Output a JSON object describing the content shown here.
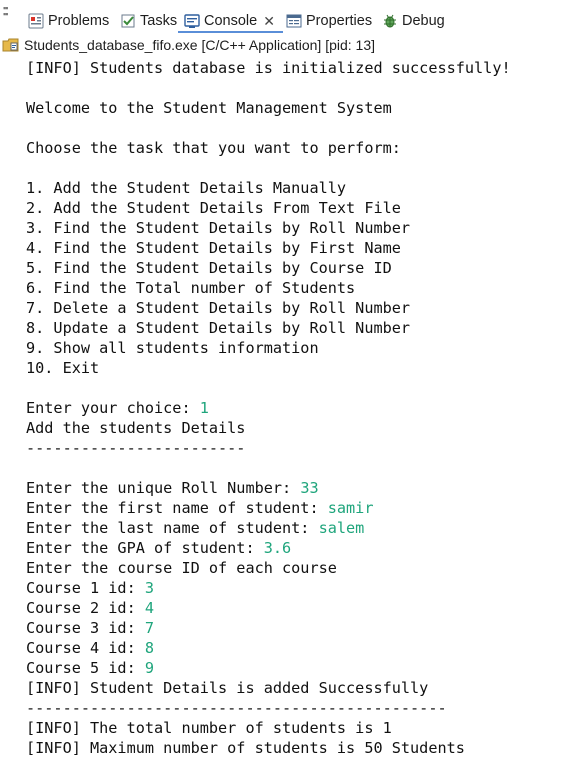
{
  "tabs": [
    {
      "label": "Problems",
      "icon": "problems-icon"
    },
    {
      "label": "Tasks",
      "icon": "tasks-icon"
    },
    {
      "label": "Console",
      "icon": "console-icon",
      "active": true
    },
    {
      "label": "Properties",
      "icon": "properties-icon"
    },
    {
      "label": "Debug",
      "icon": "debug-icon"
    }
  ],
  "process_label": "Students_database_fifo.exe [C/C++ Application]  [pid: 13]",
  "console_lines": [
    {
      "text": "[INFO] Students database is initialized successfully!",
      "input": ""
    },
    {
      "text": "",
      "input": ""
    },
    {
      "text": "Welcome to the Student Management System",
      "input": ""
    },
    {
      "text": "",
      "input": ""
    },
    {
      "text": "Choose the task that you want to perform:",
      "input": ""
    },
    {
      "text": "",
      "input": ""
    },
    {
      "text": "1. Add the Student Details Manually",
      "input": ""
    },
    {
      "text": "2. Add the Student Details From Text File",
      "input": ""
    },
    {
      "text": "3. Find the Student Details by Roll Number",
      "input": ""
    },
    {
      "text": "4. Find the Student Details by First Name",
      "input": ""
    },
    {
      "text": "5. Find the Student Details by Course ID",
      "input": ""
    },
    {
      "text": "6. Find the Total number of Students",
      "input": ""
    },
    {
      "text": "7. Delete a Student Details by Roll Number",
      "input": ""
    },
    {
      "text": "8. Update a Student Details by Roll Number",
      "input": ""
    },
    {
      "text": "9. Show all students information",
      "input": ""
    },
    {
      "text": "10. Exit",
      "input": ""
    },
    {
      "text": "",
      "input": ""
    },
    {
      "text": "Enter your choice: ",
      "input": "1"
    },
    {
      "text": "Add the students Details",
      "input": ""
    },
    {
      "text": "------------------------",
      "input": ""
    },
    {
      "text": "",
      "input": ""
    },
    {
      "text": "Enter the unique Roll Number: ",
      "input": "33"
    },
    {
      "text": "Enter the first name of student: ",
      "input": "samir"
    },
    {
      "text": "Enter the last name of student: ",
      "input": "salem"
    },
    {
      "text": "Enter the GPA of student: ",
      "input": "3.6"
    },
    {
      "text": "Enter the course ID of each course",
      "input": ""
    },
    {
      "text": "Course 1 id: ",
      "input": "3"
    },
    {
      "text": "Course 2 id: ",
      "input": "4"
    },
    {
      "text": "Course 3 id: ",
      "input": "7"
    },
    {
      "text": "Course 4 id: ",
      "input": "8"
    },
    {
      "text": "Course 5 id: ",
      "input": "9"
    },
    {
      "text": "[INFO] Student Details is added Successfully",
      "input": ""
    },
    {
      "text": "----------------------------------------------",
      "input": ""
    },
    {
      "text": "[INFO] The total number of students is 1",
      "input": ""
    },
    {
      "text": "[INFO] Maximum number of students is 50 Students",
      "input": ""
    }
  ],
  "colors": {
    "input_text": "#1fa57c",
    "active_tab_underline": "#5a8ed8"
  }
}
